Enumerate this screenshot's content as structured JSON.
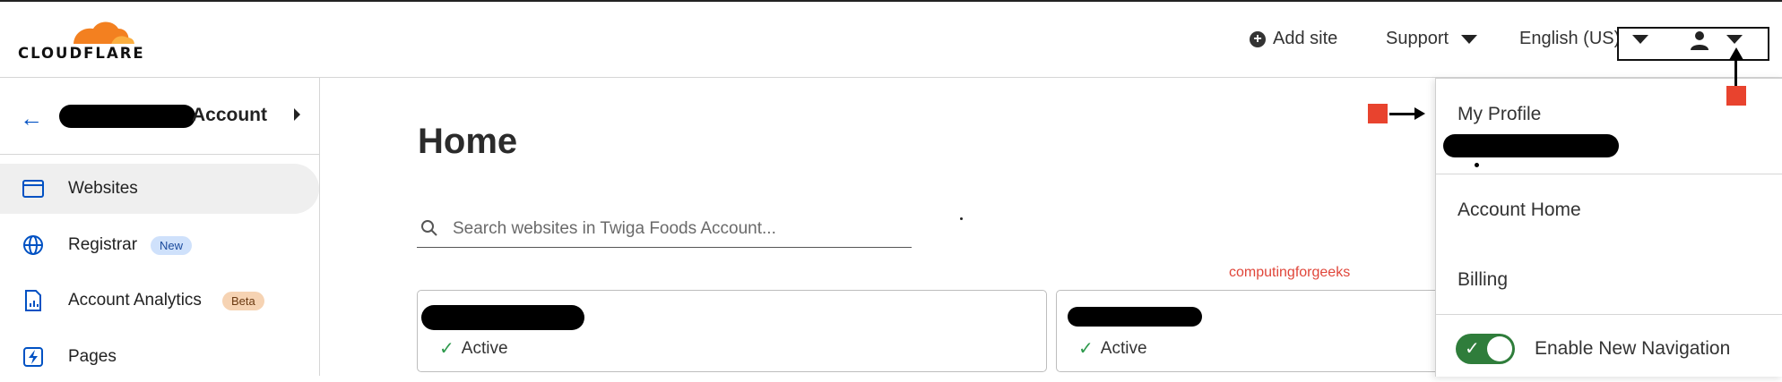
{
  "brand": {
    "name": "CLOUDFLARE",
    "accent": "#f38020",
    "accent_light": "#faae40"
  },
  "header": {
    "add_site": "Add site",
    "support": "Support",
    "language": "English (US)",
    "user_menu_icon": "user-icon"
  },
  "sidebar": {
    "account_suffix": "Account",
    "items": [
      {
        "label": "Websites",
        "icon": "browser-window-icon",
        "selected": true
      },
      {
        "label": "Registrar",
        "icon": "globe-icon",
        "badge": "New"
      },
      {
        "label": "Account Analytics",
        "icon": "analytics-doc-icon",
        "badge": "Beta"
      },
      {
        "label": "Pages",
        "icon": "bolt-icon"
      }
    ]
  },
  "main": {
    "title": "Home",
    "search_placeholder": "Search websites in Twiga Foods Account...",
    "watermark": "computingforgeeks",
    "cards": [
      {
        "status": "Active"
      },
      {
        "status": "Active"
      }
    ]
  },
  "dropdown": {
    "my_profile": "My Profile",
    "account_home": "Account Home",
    "billing": "Billing",
    "enable_navigation": "Enable New Navigation",
    "toggle_on": true
  },
  "colors": {
    "link_blue": "#0051c3",
    "active_green": "#2e9a4d",
    "toggle_green": "#2f7d3b",
    "annotation_red": "#e8432e",
    "new_badge_bg": "#cfe1fb",
    "beta_badge_bg": "#f6d3b3"
  }
}
